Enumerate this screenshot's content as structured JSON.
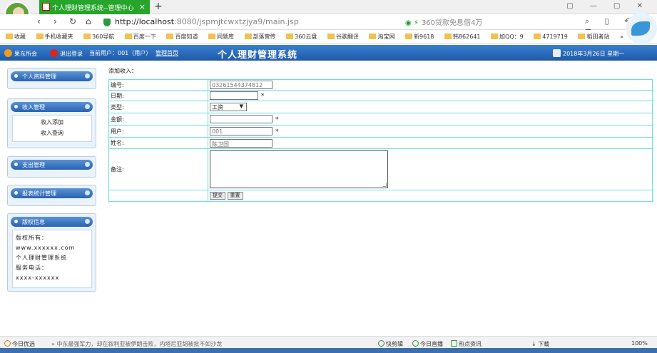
{
  "browser": {
    "tab_title": "个人理财管理系统--管理中心",
    "new_tab": "+",
    "url_host": "http://localhost",
    "url_path": ":8080/jspmjtcwxtzjya9/main.jsp",
    "search_hint": "360贷款免息借4万",
    "window_controls": "▢ — ▢ ✕",
    "nav_tools": "⌕ ▯ ↶ ≡",
    "bookmarks": [
      "收藏",
      "手机收藏夹",
      "360导航",
      "百度一下",
      "百度知道",
      "同题库",
      "部落营传",
      "360云盘",
      "谷歌翻译",
      "淘宝网",
      "新9618",
      "韩862641",
      "加QQ：9",
      "4719719",
      "稻田者站",
      "»"
    ]
  },
  "header": {
    "home_label": "果东所会",
    "logout_label": "退出登录",
    "current_user": "当前用户：001（用户）",
    "manage_home": "管理首页",
    "system_title": "个人理财管理系统",
    "date_text": "2018年3月26日 星期一"
  },
  "sidebar": {
    "panels": [
      {
        "title": "个人资料管理",
        "links": []
      },
      {
        "title": "收入管理",
        "links": [
          "收入添加",
          "收入查询"
        ]
      },
      {
        "title": "支出管理",
        "links": []
      },
      {
        "title": "报表统计管理",
        "links": []
      }
    ],
    "info": {
      "title": "版权信息",
      "lines": [
        "版权所有：",
        "www.xxxxxx.com",
        "个人理财管理系统",
        "服务电话：",
        "xxxx-xxxxxx"
      ]
    }
  },
  "form": {
    "caption": "添加收入：",
    "fields": {
      "id_label": "编号:",
      "id_value": "03261544374812",
      "date_label": "日期:",
      "date_value": "",
      "type_label": "类型:",
      "type_value": "工资",
      "amount_label": "金额:",
      "amount_value": "",
      "user_label": "用户:",
      "user_value": "001",
      "name_label": "姓名:",
      "name_value": "陈卫国",
      "note_label": "备注:"
    },
    "required_mark": "*",
    "submit_label": "提交",
    "reset_label": "重置"
  },
  "statusbar": {
    "left": "今日优选",
    "news": "中东最强军力，却在叙利亚被伊朗击败，内塔尼亚胡被批不如沙龙",
    "items": [
      "快剪辑",
      "今日直播",
      "热点资讯",
      "下载",
      "100%"
    ]
  }
}
